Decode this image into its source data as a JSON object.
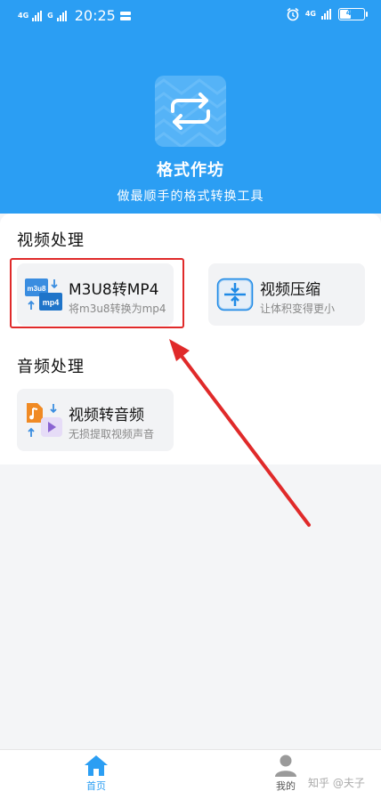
{
  "status_bar": {
    "network_left": "4G",
    "network_left2": "G",
    "time": "20:25",
    "network_right": "4G",
    "battery": "44"
  },
  "app": {
    "title": "格式作坊",
    "subtitle": "做最顺手的格式转换工具",
    "brand_color": "#2b9ef3"
  },
  "sections": {
    "video": {
      "title": "视频处理",
      "items": [
        {
          "title": "M3U8转MP4",
          "subtitle": "将m3u8转换为mp4",
          "icon_labels": [
            "m3u8",
            "mp4"
          ]
        },
        {
          "title": "视频压缩",
          "subtitle": "让体积变得更小"
        }
      ]
    },
    "audio": {
      "title": "音频处理",
      "items": [
        {
          "title": "视频转音频",
          "subtitle": "无损提取视频声音"
        }
      ]
    }
  },
  "nav": {
    "home": "首页",
    "mine": "我的"
  },
  "watermark": "知乎 @夫子",
  "annotation_color": "#e02a2a"
}
